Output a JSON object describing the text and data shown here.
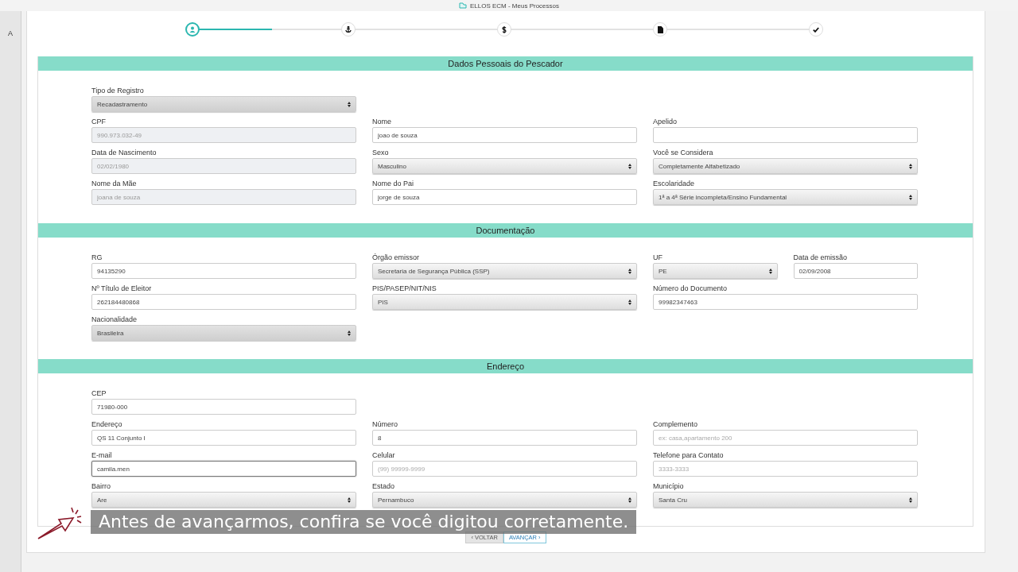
{
  "window": {
    "title": "ELLOS ECM - Meus Processos"
  },
  "background_window": {
    "text": "A"
  },
  "stepper": {
    "level": 0.12,
    "steps": [
      {
        "kind": "person",
        "selected": true
      },
      {
        "kind": "anchor",
        "selected": false
      },
      {
        "kind": "dollar",
        "selected": false
      },
      {
        "kind": "document",
        "selected": false
      },
      {
        "kind": "check",
        "selected": false
      }
    ]
  },
  "sections": [
    {
      "title": "Dados Pessoais do Pescador",
      "rows": [
        {
          "fields": [
            {
              "label": "Tipo de Registro",
              "kind": "select",
              "value": "Recadastramento",
              "disabled": true
            }
          ]
        },
        {
          "fields": [
            {
              "label": "CPF",
              "kind": "input",
              "value": "990.973.032-49",
              "disabled": true
            },
            {
              "label": "Nome",
              "kind": "input",
              "value": "joao de souza",
              "disabled": false
            },
            {
              "label": "Apelido",
              "kind": "input",
              "disabled": false
            }
          ]
        },
        {
          "fields": [
            {
              "label": "Data de Nascimento",
              "kind": "input",
              "value": "02/02/1980",
              "disabled": true
            },
            {
              "label": "Sexo",
              "kind": "select",
              "value": "Masculino",
              "disabled": false
            },
            {
              "label": "Você se Considera",
              "kind": "select",
              "value": "Completamente Alfabetizado",
              "disabled": false
            }
          ]
        },
        {
          "fields": [
            {
              "label": "Nome da Mãe",
              "kind": "input",
              "value": "joana de souza",
              "disabled": true
            },
            {
              "label": "Nome do Pai",
              "kind": "input",
              "value": "jorge de souza",
              "disabled": false
            },
            {
              "label": "Escolaridade",
              "kind": "select",
              "value": "1ª a 4ª Série incompleta/Ensino Fundamental",
              "disabled": false
            }
          ]
        }
      ]
    },
    {
      "title": "Documentação",
      "rows": [
        {
          "fields": [
            {
              "label": "RG",
              "kind": "input",
              "value": "94135290",
              "disabled": false
            },
            {
              "label": "Órgão emissor",
              "kind": "select",
              "value": "Secretaria de Segurança Pública (SSP)",
              "disabled": false
            },
            {
              "label": "UF",
              "kind": "select",
              "value": "PE",
              "disabled": false
            },
            {
              "label": "Data de emissão",
              "kind": "input",
              "value": "02/09/2008",
              "disabled": false
            }
          ]
        },
        {
          "fields": [
            {
              "label": "Nº Título de Eleitor",
              "kind": "input",
              "value": "262184480868",
              "disabled": false
            },
            {
              "label": "PIS/PASEP/NIT/NIS",
              "kind": "select",
              "value": "PIS",
              "disabled": false
            },
            {
              "label": "Número do Documento",
              "kind": "input",
              "value": "99982347463",
              "disabled": false
            }
          ]
        },
        {
          "fields": [
            {
              "label": "Nacionalidade",
              "kind": "select",
              "value": "Brasileira",
              "disabled": true
            }
          ]
        }
      ]
    },
    {
      "title": "Endereço",
      "rows": [
        {
          "fields": [
            {
              "label": "CEP",
              "kind": "input",
              "value": "71980-000",
              "disabled": false
            }
          ]
        },
        {
          "fields": [
            {
              "label": "Endereço",
              "kind": "input",
              "value": "QS 11 Conjunto I",
              "disabled": false
            },
            {
              "label": "Número",
              "kind": "input",
              "value": "8",
              "disabled": false
            },
            {
              "label": "Complemento",
              "kind": "input",
              "placeholder": "ex: casa,apartamento 200",
              "disabled": false
            }
          ]
        },
        {
          "fields": [
            {
              "label": "E-mail",
              "kind": "input",
              "value": "camila.men",
              "disabled": false,
              "focused": true
            },
            {
              "label": "Celular",
              "kind": "input",
              "placeholder": "(99) 99999-9999",
              "disabled": false
            },
            {
              "label": "Telefone para Contato",
              "kind": "input",
              "placeholder": "3333-3333",
              "disabled": false
            }
          ]
        },
        {
          "fields": [
            {
              "label": "Bairro",
              "kind": "select",
              "value": "Are",
              "disabled": false
            },
            {
              "label": "Estado",
              "kind": "select",
              "value": "Pernambuco",
              "disabled": false
            },
            {
              "label": "Município",
              "kind": "select",
              "value": "Santa Cru",
              "disabled": false
            }
          ]
        }
      ]
    }
  ],
  "buttons": [
    {
      "label": "‹ VOLTAR",
      "kind": "back"
    },
    {
      "label": "AVANÇAR ›",
      "kind": "next"
    }
  ],
  "subtitle": "Antes de avançarmos, confira se você digitou corretamente."
}
